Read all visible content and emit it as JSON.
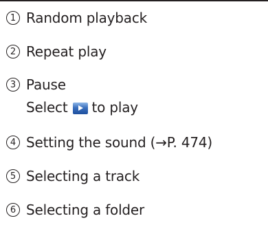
{
  "items": [
    {
      "num": "1",
      "label": "Random playback"
    },
    {
      "num": "2",
      "label": "Repeat play"
    },
    {
      "num": "3",
      "label": "Pause",
      "sub": {
        "before": "Select",
        "icon": "play-icon",
        "after": "to play"
      }
    },
    {
      "num": "4",
      "label": "Setting the sound (→P. 474)"
    },
    {
      "num": "5",
      "label": "Selecting a track"
    },
    {
      "num": "6",
      "label": "Selecting a folder"
    }
  ]
}
